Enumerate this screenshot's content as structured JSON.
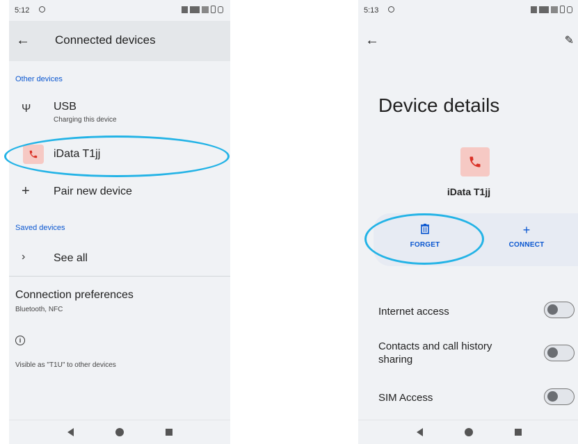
{
  "left": {
    "status": {
      "time": "5:12"
    },
    "title": "Connected devices",
    "other_devices_label": "Other devices",
    "usb": {
      "title": "USB",
      "subtitle": "Charging this device"
    },
    "device": {
      "name": "iData T1jj"
    },
    "pair": {
      "label": "Pair new device"
    },
    "saved_devices_label": "Saved devices",
    "see_all": {
      "label": "See all"
    },
    "prefs": {
      "title": "Connection preferences",
      "subtitle": "Bluetooth, NFC"
    },
    "visible_text": "Visible as \"T1U\" to other devices"
  },
  "right": {
    "status": {
      "time": "5:13"
    },
    "title": "Device details",
    "device_name": "iData T1jj",
    "forget_label": "FORGET",
    "connect_label": "CONNECT",
    "toggles": [
      {
        "label": "Internet access",
        "on": false
      },
      {
        "label": "Contacts and call history sharing",
        "on": false
      },
      {
        "label": "SIM Access",
        "on": false
      }
    ]
  },
  "colors": {
    "accent": "#0b57d0",
    "highlight": "#23b3e6",
    "device_badge": "#f6c9c4",
    "phone_icon": "#d93025"
  },
  "icons": {
    "usb": "usb-icon",
    "phone": "phone-icon",
    "plus": "plus-icon",
    "chevron": "chevron-right-icon",
    "info": "info-icon",
    "trash": "trash-icon",
    "edit": "edit-icon",
    "back": "back-arrow-icon"
  }
}
